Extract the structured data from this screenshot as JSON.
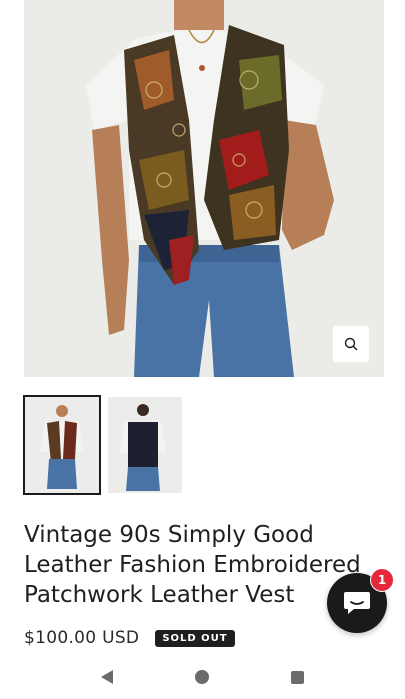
{
  "product": {
    "title": "Vintage 90s Simply Good Leather Fashion Embroidered Patchwork Leather Vest",
    "price": "$100.00 USD",
    "status_badge": "SOLD OUT"
  },
  "gallery": {
    "zoom_icon": "search-icon",
    "thumbnails": [
      {
        "name": "front-view",
        "selected": true
      },
      {
        "name": "back-view",
        "selected": false
      }
    ]
  },
  "chat": {
    "icon": "chat-bubble-icon",
    "unread_count": "1"
  },
  "navbar": {
    "icons": [
      "back-icon",
      "home-icon",
      "recents-icon"
    ]
  },
  "colors": {
    "text": "#1c1c1c",
    "badge_bg": "#1f1f1f",
    "notification": "#e4293c",
    "photo_bg": "#ececea"
  }
}
